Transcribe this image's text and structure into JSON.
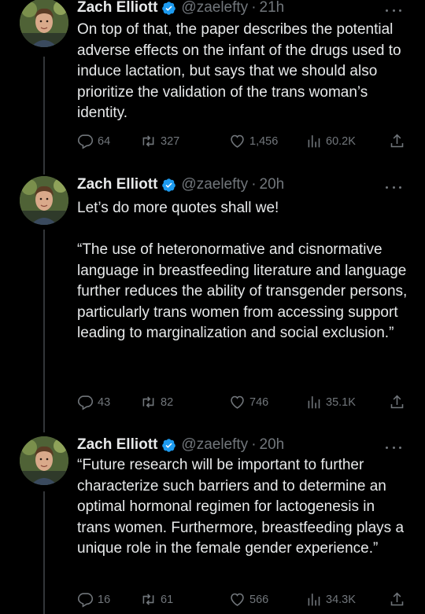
{
  "tweets": [
    {
      "author_name": "Zach Elliott",
      "handle": "@zaelefty",
      "dot": "·",
      "time": "21h",
      "text": "On top of that, the paper describes the potential adverse effects on the infant of the drugs used to induce lactation, but says that we should also prioritize the validation of the trans woman’s identity.",
      "replies": "64",
      "reposts": "327",
      "likes": "1,456",
      "views": "60.2K"
    },
    {
      "author_name": "Zach Elliott",
      "handle": "@zaelefty",
      "dot": "·",
      "time": "20h",
      "text": "Let’s do more quotes shall we!\n\n“The use of heteronormative and cisnormative language in breastfeeding literature and language further reduces the ability of transgender persons, particularly trans women from accessing support leading to marginalization and social exclusion.”",
      "replies": "43",
      "reposts": "82",
      "likes": "746",
      "views": "35.1K"
    },
    {
      "author_name": "Zach Elliott",
      "handle": "@zaelefty",
      "dot": "·",
      "time": "20h",
      "text": "“Future research will be important to further characterize such barriers and to determine an optimal hormonal regimen for lactogenesis in trans women. Furthermore, breastfeeding plays a unique role in the female gender experience.”",
      "replies": "16",
      "reposts": "61",
      "likes": "566",
      "views": "34.3K"
    }
  ],
  "icons": {
    "reply": "reply-icon",
    "repost": "repost-icon",
    "like": "heart-icon",
    "views": "views-icon",
    "share": "share-icon",
    "verified": "verified-badge-icon",
    "more": "more-icon"
  },
  "colors": {
    "background": "#000000",
    "text": "#e7e9ea",
    "muted": "#71767b",
    "verified": "#1d9bf0",
    "thread_line": "#333639"
  }
}
